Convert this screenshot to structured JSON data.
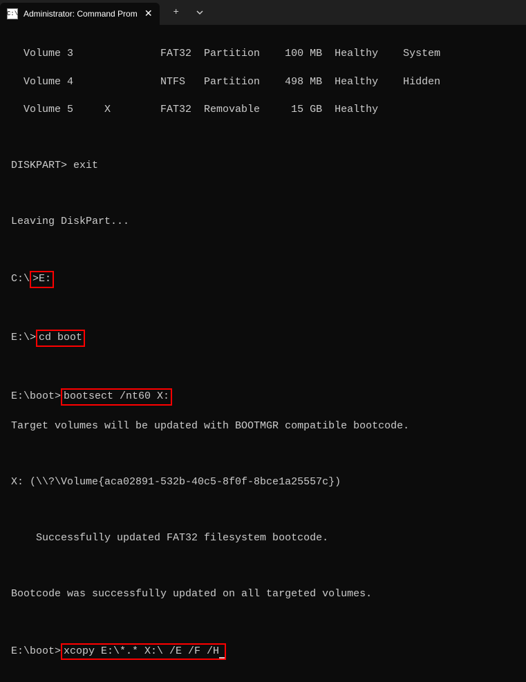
{
  "tab": {
    "title": "Administrator: Command Prom",
    "icon_label": "C:\\"
  },
  "volumes": [
    {
      "label": "  Volume 3              FAT32  Partition    100 MB  Healthy    System"
    },
    {
      "label": "  Volume 4              NTFS   Partition    498 MB  Healthy    Hidden"
    },
    {
      "label": "  Volume 5     X        FAT32  Removable     15 GB  Healthy"
    }
  ],
  "lines": {
    "diskpart_exit_prefix": "DISKPART> ",
    "diskpart_exit_cmd": "exit",
    "leaving": "Leaving DiskPart...",
    "p1_prefix": "C:\\",
    "p1_cmd": ">E:",
    "p2_prefix": "E:\\>",
    "p2_cmd": "cd boot",
    "p3_prefix": "E:\\boot>",
    "p3_cmd": "bootsect /nt60 X:",
    "target_update": "Target volumes will be updated with BOOTMGR compatible bootcode.",
    "volume_guid": "X: (\\\\?\\Volume{aca02891-532b-40c5-8f0f-8bce1a25557c})",
    "success_fs": "    Successfully updated FAT32 filesystem bootcode.",
    "bootcode_success": "Bootcode was successfully updated on all targeted volumes.",
    "p4_prefix": "E:\\boot>",
    "p4_cmd": "xcopy E:\\*.* X:\\ /E /F /H"
  }
}
